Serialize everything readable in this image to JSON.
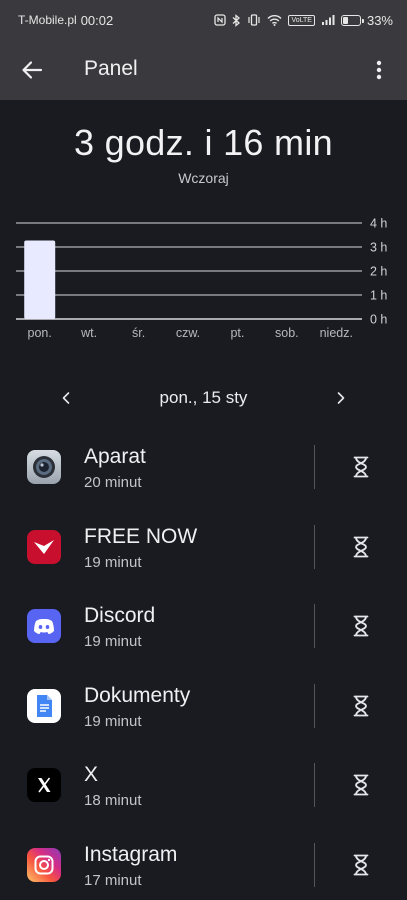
{
  "status_bar": {
    "carrier": "T-Mobile.pl",
    "time": "00:02",
    "volte": "VoLTE",
    "battery_percent": "33%",
    "battery_level": 0.33,
    "icons": [
      "nfc-icon",
      "bluetooth-icon",
      "vibrate-icon",
      "wifi-icon",
      "volte-icon",
      "signal-icon",
      "battery-icon"
    ]
  },
  "app_bar": {
    "title": "Panel",
    "back_icon": "arrow-back-icon",
    "more_icon": "more-vert-icon"
  },
  "summary": {
    "total": "3 godz. i 16 min",
    "period": "Wczoraj"
  },
  "chart_data": {
    "type": "bar",
    "categories": [
      "pon.",
      "wt.",
      "śr.",
      "czw.",
      "pt.",
      "sob.",
      "niedz."
    ],
    "values": [
      3.27,
      0,
      0,
      0,
      0,
      0,
      0
    ],
    "ylim": [
      0,
      4
    ],
    "y_ticks": [
      "0 h",
      "1 h",
      "2 h",
      "3 h",
      "4 h"
    ],
    "y_axis_side": "right",
    "grid": true,
    "bar_color": "#e8eaff",
    "grid_color": "#d8d8dc"
  },
  "date_nav": {
    "prev_icon": "chevron-left-icon",
    "label": "pon., 15 sty",
    "next_icon": "chevron-right-icon"
  },
  "apps": [
    {
      "name": "Aparat",
      "usage": "20 minut",
      "icon": "camera-app-icon"
    },
    {
      "name": "FREE NOW",
      "usage": "19 minut",
      "icon": "freenow-app-icon"
    },
    {
      "name": "Discord",
      "usage": "19 minut",
      "icon": "discord-app-icon"
    },
    {
      "name": "Dokumenty",
      "usage": "19 minut",
      "icon": "docs-app-icon"
    },
    {
      "name": "X",
      "usage": "18 minut",
      "icon": "x-app-icon"
    },
    {
      "name": "Instagram",
      "usage": "17 minut",
      "icon": "instagram-app-icon"
    }
  ],
  "timer_icon": "hourglass-icon",
  "colors": {
    "background": "#1a1b20",
    "app_bar": "#3a3a3e",
    "freenow_red": "#c8102e",
    "discord_blurple": "#5865f2",
    "docs_blue": "#4285f4"
  }
}
